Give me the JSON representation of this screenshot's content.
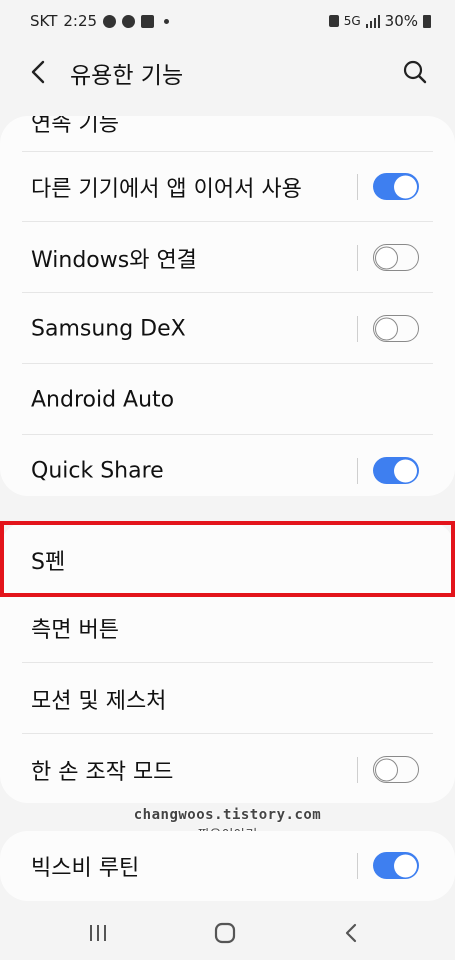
{
  "status_bar": {
    "carrier": "SKT",
    "time": "2:25",
    "network": "5G",
    "battery": "30%"
  },
  "header": {
    "title": "유용한 기능"
  },
  "cut_off_item": "연속 기능",
  "card1_items": [
    {
      "label": "다른 기기에서 앱 이어서 사용",
      "toggle": "on"
    },
    {
      "label": "Windows와 연결",
      "toggle": "off"
    },
    {
      "label": "Samsung DeX",
      "toggle": "off"
    },
    {
      "label": "Android Auto",
      "toggle": "none"
    },
    {
      "label": "Quick Share",
      "toggle": "on"
    }
  ],
  "card2_items": [
    {
      "label": "S펜",
      "toggle": "none"
    },
    {
      "label": "측면 버튼",
      "toggle": "none"
    },
    {
      "label": "모션 및 제스처",
      "toggle": "none"
    },
    {
      "label": "한 손 조작 모드",
      "toggle": "off"
    }
  ],
  "card3_items": [
    {
      "label": "빅스비 루틴",
      "toggle": "on"
    }
  ],
  "watermark": {
    "line1": "changwoos.tistory.com",
    "line2": "짱우이야기"
  },
  "colors": {
    "accent": "#3e7ff0",
    "highlight": "#e3141b",
    "background": "#f4f4f4",
    "card": "#fcfcfc"
  },
  "icons": [
    "back-arrow-icon",
    "search-icon",
    "recent-apps-icon",
    "home-icon",
    "back-nav-icon"
  ]
}
